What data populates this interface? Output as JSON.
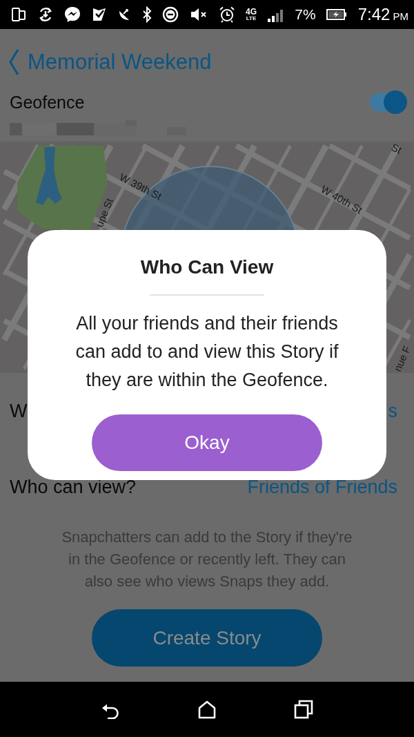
{
  "status_bar": {
    "network": "4G",
    "network_sub": "LTE",
    "battery": "7%",
    "time": "7:42",
    "meridiem": "PM"
  },
  "header": {
    "title": "Memorial Weekend"
  },
  "geofence": {
    "label": "Geofence",
    "on": true
  },
  "map": {
    "street_labels": [
      {
        "text": "W 39th St"
      },
      {
        "text": "W 40th St"
      },
      {
        "text": "upe St"
      },
      {
        "text": "nue F"
      },
      {
        "text": "St"
      }
    ]
  },
  "settings_rows": [
    {
      "label": "W",
      "value": "s"
    },
    {
      "label": "Who can view?",
      "value": "Friends of Friends"
    }
  ],
  "description": "Snapchatters can add to the Story if they're in the Geofence or recently left. They can also see who views Snaps they add.",
  "create_button": "Create Story",
  "dialog": {
    "title": "Who Can View",
    "body": "All your friends and their friends can add to and view this Story if they are within the Geofence.",
    "button": "Okay"
  }
}
